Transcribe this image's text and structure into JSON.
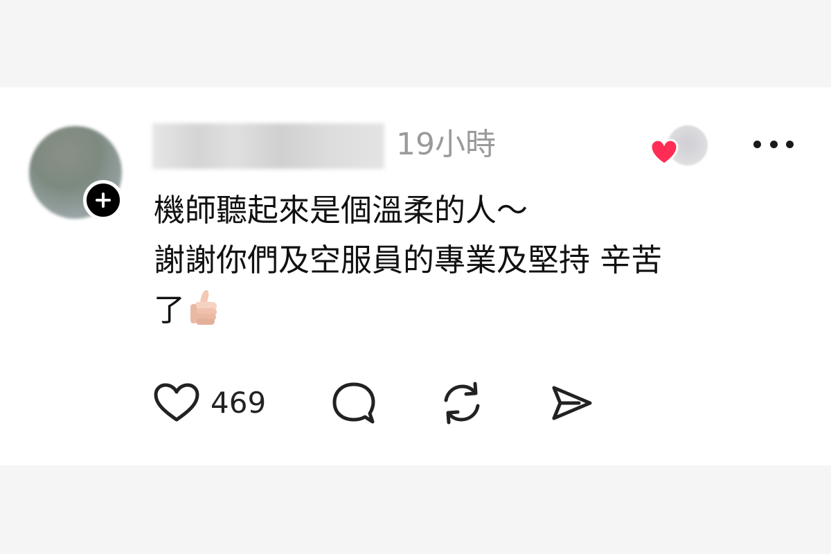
{
  "post": {
    "timestamp": "19小時",
    "comment_lines": [
      "機師聽起來是個溫柔的人～",
      "謝謝你們及空服員的專業及堅持 辛苦",
      "了"
    ],
    "trailing_emoji": "thumbs-up-icon"
  },
  "actions": {
    "like_count": "469",
    "like_icon": "heart-outline-icon",
    "reply_icon": "speech-bubble-icon",
    "repost_icon": "repost-icon",
    "share_icon": "send-icon"
  },
  "colors": {
    "liked_heart": "#ff2d55",
    "text": "#111111",
    "muted_text": "#9a9a9a",
    "page_background": "#f5f5f5",
    "card_background": "#ffffff"
  }
}
